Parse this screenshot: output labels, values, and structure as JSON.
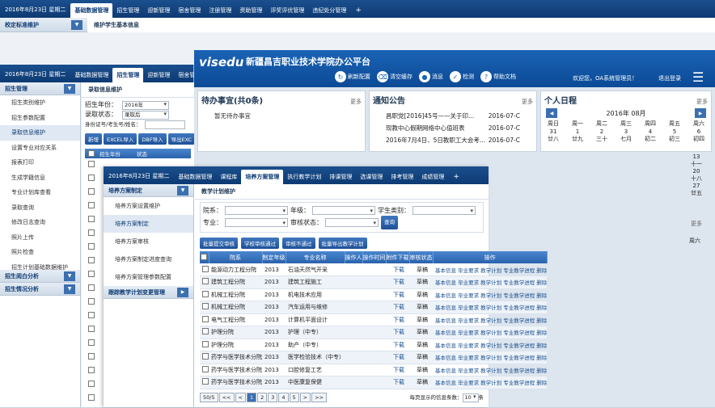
{
  "l1": {
    "date": "2016年8月23日 星期二",
    "tabs": [
      "基础数据管理",
      "招生管理",
      "迎新管理",
      "宿舍管理",
      "注册管理",
      "资助管理",
      "评奖评优管理",
      "违纪处分管理"
    ],
    "active_tab": 0,
    "plus": "+",
    "sidebar_title": "校定标准维护",
    "breadcrumb": "维护学生基本信息"
  },
  "l2": {
    "date": "2016年8月23日 星期二",
    "tabs": [
      "基础数据管理",
      "招生管理",
      "迎新管理",
      "宿舍管"
    ],
    "active_tab": 1,
    "sidebar_title": "招生管理",
    "sidebar_items": [
      "招生类别维护",
      "招生参数配置",
      "录取信息维护",
      "设置专业对应关系",
      "报表打印",
      "生成学籍信息",
      "专业计划库查看",
      "录取查询",
      "修改日志查询",
      "照片上传",
      "照片检查",
      "招生计划基础数据维护"
    ],
    "active_item": 2,
    "sidebar_groups": [
      "招生阅白分析",
      "招生情况分析"
    ],
    "panel_title": "录取信息维护",
    "form": {
      "year_label": "招生年份：",
      "year_value": "2016年",
      "status_label": "录取状态：",
      "status_value": "录取后",
      "id_label": "身份证号/考生号/姓名："
    },
    "buttons": [
      "新增",
      "EXCEL导入",
      "DBF导入",
      "导出EXC"
    ],
    "col_year": "招生年份",
    "col_status": "状态"
  },
  "app": {
    "logo": "visedu",
    "subtitle": "Wisedu Campus Info System",
    "title": "新疆昌吉职业技术学院办公平台",
    "tools": [
      {
        "icon": "refresh-icon",
        "glyph": "↻",
        "label": "刷新配置"
      },
      {
        "icon": "clear-cache-icon",
        "glyph": "⌫",
        "label": "清空缓存"
      },
      {
        "icon": "bell-icon",
        "glyph": "●",
        "label": "消息"
      },
      {
        "icon": "check-icon",
        "glyph": "✓",
        "label": "检测"
      },
      {
        "icon": "help-icon",
        "glyph": "?",
        "label": "帮助文档"
      }
    ],
    "welcome": "欢迎您，OA系统管理员！",
    "logout": "退出登录",
    "todo_title": "待办事宜(共0条)",
    "todo_empty": "暂无待办事宜",
    "more": "更多",
    "notice_title": "通知公告",
    "notices": [
      {
        "text": "昌职党[2016]45号——关于印...",
        "date": "2016-07-C"
      },
      {
        "text": "现教中心假期网络中心值班表",
        "date": "2016-07-C"
      },
      {
        "text": "2016年7月4日、5日教职工大会考...",
        "date": "2016-07-C"
      }
    ],
    "cal_title": "个人日程",
    "cal_month": "2016年 08月",
    "cal_head": [
      "周日",
      "周一",
      "周二",
      "周三",
      "周四",
      "周五",
      "周六"
    ],
    "cal_rows": [
      [
        "31",
        "1",
        "2",
        "3",
        "4",
        "5",
        "6"
      ],
      [
        "廿八",
        "廿九",
        "三十",
        "七月",
        "初二",
        "初三",
        "初四"
      ]
    ],
    "cal_right": [
      "13",
      "十一",
      "20",
      "十八",
      "27",
      "廿五"
    ],
    "cal_more": "更多",
    "cal_week": "周六"
  },
  "l4": {
    "date": "2016年8月23日 星期二",
    "tabs": [
      "基础数据管理",
      "课程库",
      "培养方案管理",
      "执行教学计划",
      "排课管理",
      "选课管理",
      "排考管理",
      "成绩管理"
    ],
    "active_tab": 2,
    "sidebar_title": "培养方案制定",
    "sidebar_items": [
      "培养方案设置维护",
      "培养方案制定",
      "培养方案审核",
      "培养方案制定进度查询",
      "培养方案管理参数配置"
    ],
    "active_item": 1,
    "sidebar_group2": "跟踪教学计划变更管理",
    "panel_title": "教学计划维护",
    "filters": {
      "dept": "院系：",
      "grade": "年级：",
      "stu_type": "学生类别：",
      "major": "专业：",
      "audit": "审核状态：",
      "query": "查询"
    },
    "actions": [
      "批量提交审核",
      "学校审核通过",
      "审核不通过",
      "批量导出教学计划"
    ],
    "columns": [
      "院系",
      "制定年级",
      "专业名称",
      "操作人",
      "操作时间",
      "附件下载",
      "审核状态",
      "操作"
    ],
    "rows": [
      [
        "能源动力工程分院",
        "2013",
        "石油天然气开采",
        "",
        "",
        "下载",
        "草稿"
      ],
      [
        "建筑工程分院",
        "2013",
        "建筑工程施工",
        "",
        "",
        "下载",
        "草稿"
      ],
      [
        "机械工程分院",
        "2013",
        "机电技术应用",
        "",
        "",
        "下载",
        "草稿"
      ],
      [
        "机械工程分院",
        "2013",
        "汽车运用与维修",
        "",
        "",
        "下载",
        "草稿"
      ],
      [
        "电气工程分院",
        "2013",
        "计算机平面设计",
        "",
        "",
        "下载",
        "草稿"
      ],
      [
        "护理分院",
        "2013",
        "护理（中专）",
        "",
        "",
        "下载",
        "草稿"
      ],
      [
        "护理分院",
        "2013",
        "助产（中专）",
        "",
        "",
        "下载",
        "草稿"
      ],
      [
        "药学与医学技术分院",
        "2013",
        "医学检验技术（中专）",
        "",
        "",
        "下载",
        "草稿"
      ],
      [
        "药学与医学技术分院",
        "2013",
        "口腔修复工艺",
        "",
        "",
        "下载",
        "草稿"
      ],
      [
        "药学与医学技术分院",
        "2013",
        "中医康复保健",
        "",
        "",
        "下载",
        "草稿"
      ]
    ],
    "row_ops": "基本信息 毕业要求 教学计划 专业教学进程 删除",
    "pager": {
      "total": "50/5",
      "prev": "<<",
      "first": "<",
      "pages": [
        "1",
        "2",
        "3",
        "4",
        "5"
      ],
      "next": ">",
      "last": ">>",
      "per_page_label": "每页显示的信息条数：",
      "per_page": "10",
      "unit": "条"
    }
  }
}
